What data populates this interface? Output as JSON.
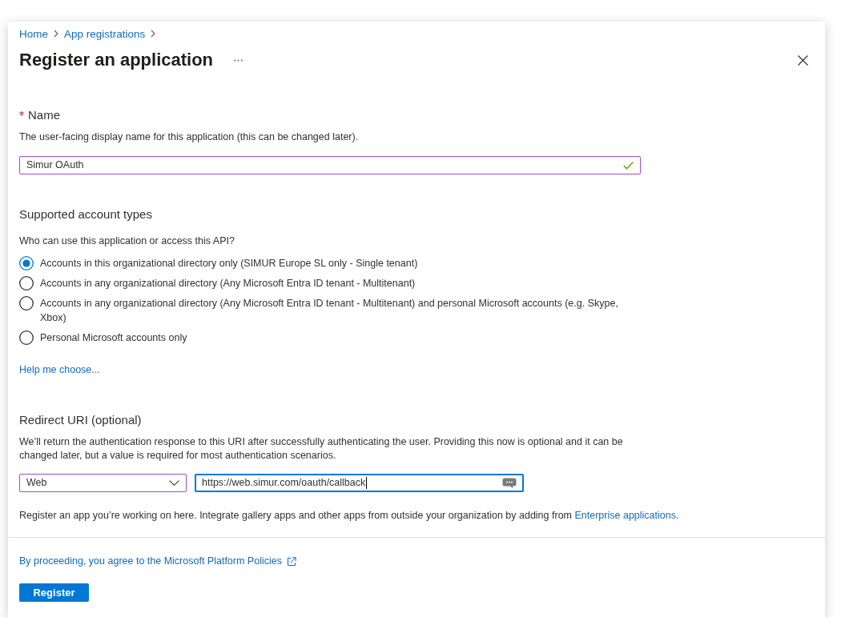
{
  "breadcrumb": [
    {
      "label": "Home"
    },
    {
      "label": "App registrations"
    }
  ],
  "title": "Register an application",
  "name_field": {
    "label": "Name",
    "required": true,
    "description": "The user-facing display name for this application (this can be changed later).",
    "value": "Simur OAuth",
    "modified": true,
    "valid": true
  },
  "account_types": {
    "heading": "Supported account types",
    "question": "Who can use this application or access this API?",
    "options": [
      {
        "label": "Accounts in this organizational directory only (SIMUR Europe SL only - Single tenant)",
        "selected": true
      },
      {
        "label": "Accounts in any organizational directory (Any Microsoft Entra ID tenant - Multitenant)",
        "selected": false
      },
      {
        "label": "Accounts in any organizational directory (Any Microsoft Entra ID tenant - Multitenant) and personal Microsoft accounts (e.g. Skype, Xbox)",
        "selected": false
      },
      {
        "label": "Personal Microsoft accounts only",
        "selected": false
      }
    ],
    "help_link": "Help me choose..."
  },
  "redirect_uri": {
    "heading": "Redirect URI (optional)",
    "description": "We’ll return the authentication response to this URI after successfully authenticating the user. Providing this now is optional and it can be changed later, but a value is required for most authentication scenarios.",
    "platform": {
      "value": "Web",
      "modified": true
    },
    "uri": {
      "value": "https://web.simur.com/oauth/callback",
      "focused": true
    }
  },
  "note": {
    "text": "Register an app you’re working on here. Integrate gallery apps and other apps from outside your organization by adding from",
    "link": "Enterprise applications",
    "end": "."
  },
  "footer": {
    "policy_link": "By proceeding, you agree to the Microsoft Platform Policies",
    "register_button": "Register"
  }
}
